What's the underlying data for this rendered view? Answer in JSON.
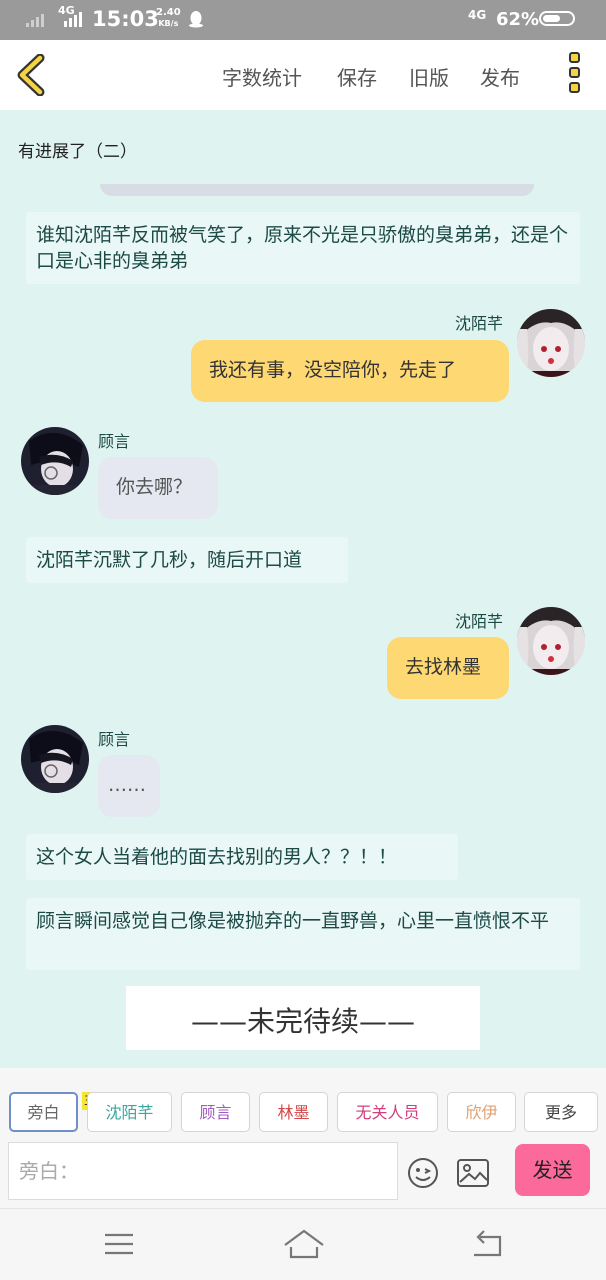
{
  "status_bar": {
    "network1": "4G",
    "time": "15:03",
    "speed_value": "2.40",
    "speed_unit": "KB/s",
    "network2": "4G",
    "battery_percent": "62%",
    "battery_level": 0.62
  },
  "top_bar": {
    "menu": [
      "字数统计",
      "保存",
      "旧版",
      "发布"
    ]
  },
  "chat": {
    "title": "有进展了（二）",
    "narration_1": "谁知沈陌芊反而被气笑了，原来不光是只骄傲的臭弟弟，还是个口是心非的臭弟弟",
    "msg_1": {
      "name": "沈陌芊",
      "text": "我还有事，没空陪你，先走了"
    },
    "msg_2": {
      "name": "顾言",
      "text": "你去哪？"
    },
    "narration_2": "沈陌芊沉默了几秒，随后开口道",
    "msg_3": {
      "name": "沈陌芊",
      "text": "去找林墨"
    },
    "msg_4": {
      "name": "顾言",
      "text": "……"
    },
    "narration_3": "这个女人当着他的面去找别的男人？？！！",
    "narration_4": "顾言瞬间感觉自己像是被抛弃的一直野兽，心里一直愤恨不平",
    "end_card": "——未完待续——"
  },
  "role_bar": {
    "main_tag": "主",
    "chips": [
      "旁白",
      "沈陌芊",
      "顾言",
      "林墨",
      "无关人员",
      "欣伊",
      "更多"
    ],
    "chip_colors": [
      "#666666",
      "#3aa8a0",
      "#a05ac0",
      "#d04848",
      "#d0407c",
      "#e0a070",
      "#444444"
    ],
    "input_placeholder": "旁白：",
    "send_label": "发送"
  }
}
